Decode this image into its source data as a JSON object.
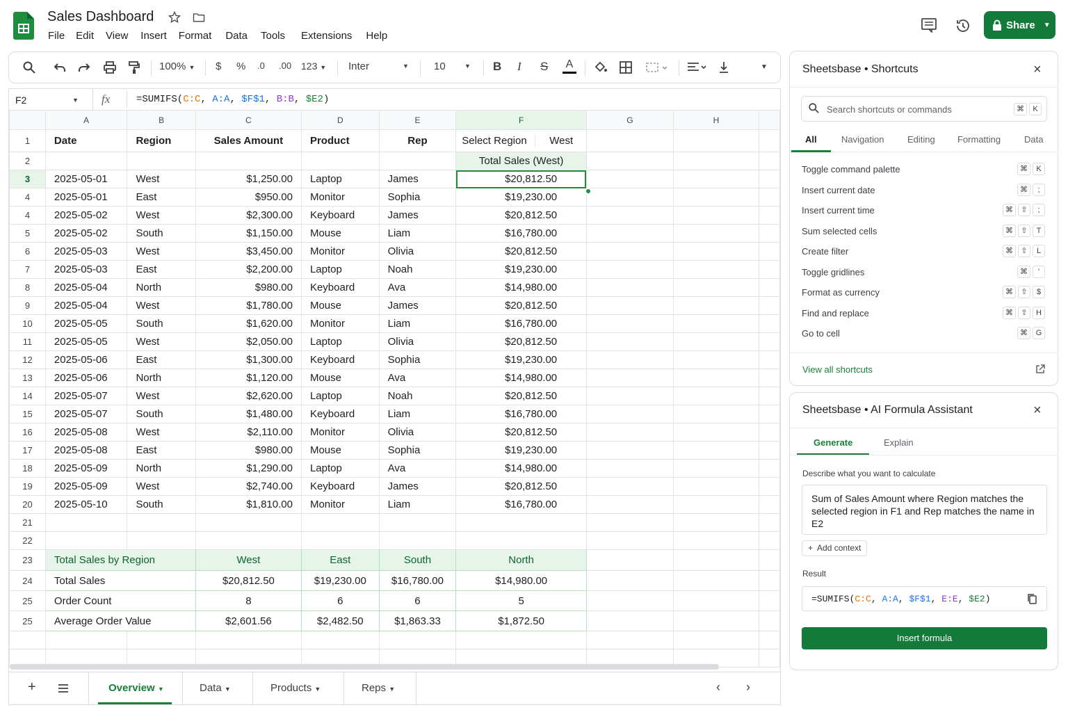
{
  "app": {
    "title": "Sales Dashboard",
    "menu": [
      "File",
      "Edit",
      "View",
      "Insert",
      "Format",
      "Data",
      "Tools",
      "Extensions",
      "Help"
    ],
    "share_label": "Share"
  },
  "toolbar": {
    "zoom": "100%",
    "currency": "$",
    "percent": "%",
    "dec_less": ".0",
    "dec_more": ".00",
    "number_format": "123",
    "font": "Inter",
    "font_size": "10"
  },
  "formula_bar": {
    "cell_ref": "F2",
    "fx": "fx"
  },
  "columns": [
    "A",
    "B",
    "C",
    "D",
    "E",
    "F",
    "G",
    "H"
  ],
  "header_row": {
    "row_num": "1",
    "cells": [
      "Date",
      "Region",
      "Sales Amount",
      "Product",
      "Rep"
    ],
    "select_region_label": "Select Region",
    "select_region_value": "West"
  },
  "row2": {
    "row_num": "2",
    "total_label": "Total Sales (West)"
  },
  "rows": [
    {
      "n": "3",
      "date": "2025-05-01",
      "region": "West",
      "amount": "$1,250.00",
      "product": "Laptop",
      "rep": "James",
      "total": "$20,812.50"
    },
    {
      "n": "4",
      "date": "2025-05-01",
      "region": "East",
      "amount": "$950.00",
      "product": "Monitor",
      "rep": "Sophia",
      "total": "$19,230.00"
    },
    {
      "n": "4",
      "date": "2025-05-02",
      "region": "West",
      "amount": "$2,300.00",
      "product": "Keyboard",
      "rep": "James",
      "total": "$20,812.50"
    },
    {
      "n": "5",
      "date": "2025-05-02",
      "region": "South",
      "amount": "$1,150.00",
      "product": "Mouse",
      "rep": "Liam",
      "total": "$16,780.00"
    },
    {
      "n": "6",
      "date": "2025-05-03",
      "region": "West",
      "amount": "$3,450.00",
      "product": "Monitor",
      "rep": "Olivia",
      "total": "$20,812.50"
    },
    {
      "n": "7",
      "date": "2025-05-03",
      "region": "East",
      "amount": "$2,200.00",
      "product": "Laptop",
      "rep": "Noah",
      "total": "$19,230.00"
    },
    {
      "n": "8",
      "date": "2025-05-04",
      "region": "North",
      "amount": "$980.00",
      "product": "Keyboard",
      "rep": "Ava",
      "total": "$14,980.00"
    },
    {
      "n": "9",
      "date": "2025-05-04",
      "region": "West",
      "amount": "$1,780.00",
      "product": "Mouse",
      "rep": "James",
      "total": "$20,812.50"
    },
    {
      "n": "10",
      "date": "2025-05-05",
      "region": "South",
      "amount": "$1,620.00",
      "product": "Monitor",
      "rep": "Liam",
      "total": "$16,780.00"
    },
    {
      "n": "11",
      "date": "2025-05-05",
      "region": "West",
      "amount": "$2,050.00",
      "product": "Laptop",
      "rep": "Olivia",
      "total": "$20,812.50"
    },
    {
      "n": "12",
      "date": "2025-05-06",
      "region": "East",
      "amount": "$1,300.00",
      "product": "Keyboard",
      "rep": "Sophia",
      "total": "$19,230.00"
    },
    {
      "n": "13",
      "date": "2025-05-06",
      "region": "North",
      "amount": "$1,120.00",
      "product": "Mouse",
      "rep": "Ava",
      "total": "$14,980.00"
    },
    {
      "n": "14",
      "date": "2025-05-07",
      "region": "West",
      "amount": "$2,620.00",
      "product": "Laptop",
      "rep": "Noah",
      "total": "$20,812.50"
    },
    {
      "n": "15",
      "date": "2025-05-07",
      "region": "South",
      "amount": "$1,480.00",
      "product": "Keyboard",
      "rep": "Liam",
      "total": "$16,780.00"
    },
    {
      "n": "16",
      "date": "2025-05-08",
      "region": "West",
      "amount": "$2,110.00",
      "product": "Monitor",
      "rep": "Olivia",
      "total": "$20,812.50"
    },
    {
      "n": "17",
      "date": "2025-05-08",
      "region": "East",
      "amount": "$980.00",
      "product": "Mouse",
      "rep": "Sophia",
      "total": "$19,230.00"
    },
    {
      "n": "18",
      "date": "2025-05-09",
      "region": "North",
      "amount": "$1,290.00",
      "product": "Laptop",
      "rep": "Ava",
      "total": "$14,980.00"
    },
    {
      "n": "19",
      "date": "2025-05-09",
      "region": "West",
      "amount": "$2,740.00",
      "product": "Keyboard",
      "rep": "James",
      "total": "$20,812.50"
    },
    {
      "n": "20",
      "date": "2025-05-10",
      "region": "South",
      "amount": "$1,810.00",
      "product": "Monitor",
      "rep": "Liam",
      "total": "$16,780.00"
    }
  ],
  "empty_rows": [
    "21",
    "22"
  ],
  "summary": {
    "header": {
      "n": "23",
      "label": "Total Sales by Region",
      "cols": [
        "West",
        "East",
        "South",
        "North"
      ]
    },
    "rows": [
      {
        "n": "24",
        "label": "Total Sales",
        "vals": [
          "$20,812.50",
          "$19,230.00",
          "$16,780.00",
          "$14,980.00"
        ]
      },
      {
        "n": "25",
        "label": "Order Count",
        "vals": [
          "8",
          "6",
          "6",
          "5"
        ]
      },
      {
        "n": "25",
        "label": "Average Order Value",
        "vals": [
          "$2,601.56",
          "$2,482.50",
          "$1,863.33",
          "$1,872.50"
        ]
      }
    ]
  },
  "sheet_tabs": [
    "Overview",
    "Data",
    "Products",
    "Reps"
  ],
  "shortcuts_panel": {
    "title": "Sheetsbase • Shortcuts",
    "search_placeholder": "Search shortcuts or commands",
    "search_keys": [
      "⌘",
      "K"
    ],
    "tabs": [
      "All",
      "Navigation",
      "Editing",
      "Formatting",
      "Data"
    ],
    "items": [
      {
        "label": "Toggle command palette",
        "keys": [
          "⌘",
          "K"
        ]
      },
      {
        "label": "Insert current date",
        "keys": [
          "⌘",
          ";"
        ]
      },
      {
        "label": "Insert current time",
        "keys": [
          "⌘",
          "⇧",
          ";"
        ]
      },
      {
        "label": "Sum selected cells",
        "keys": [
          "⌘",
          "⇧",
          "T"
        ]
      },
      {
        "label": "Create filter",
        "keys": [
          "⌘",
          "⇧",
          "L"
        ]
      },
      {
        "label": "Toggle gridlines",
        "keys": [
          "⌘",
          "'"
        ]
      },
      {
        "label": "Format as currency",
        "keys": [
          "⌘",
          "⇧",
          "$"
        ]
      },
      {
        "label": "Find and replace",
        "keys": [
          "⌘",
          "⇧",
          "H"
        ]
      },
      {
        "label": "Go to cell",
        "keys": [
          "⌘",
          "G"
        ]
      }
    ],
    "view_all": "View all shortcuts"
  },
  "ai_panel": {
    "title": "Sheetsbase • AI Formula Assistant",
    "tabs": [
      "Generate",
      "Explain"
    ],
    "describe_label": "Describe what you want to calculate",
    "prompt": "Sum of Sales Amount where Region matches the selected region in F1 and Rep matches the name in E2",
    "add_context": "Add context",
    "result_label": "Result",
    "insert_label": "Insert formula"
  },
  "colors": {
    "accent": "#147a3a",
    "selection": "#1e8e3e",
    "summary_bg": "#e6f4ea"
  }
}
